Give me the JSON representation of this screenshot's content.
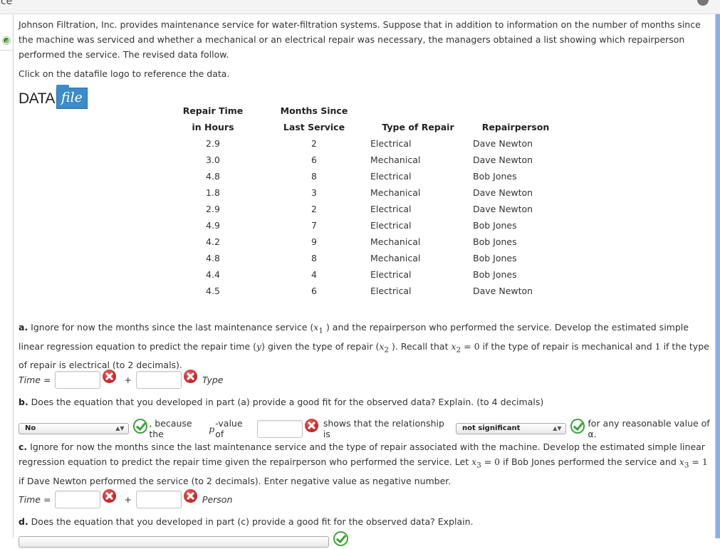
{
  "header": {
    "title": "ice",
    "info_icon": "info-icon"
  },
  "intro": {
    "text": "Johnson Filtration, Inc. provides maintenance service for water-filtration systems. Suppose that in addition to information on the number of months since the machine was serviced and whether a mechanical or an electrical repair was necessary, the managers obtained a list showing which repairperson performed the service. The revised data follow.",
    "click_note": "Click on the datafile logo to reference the data.",
    "datafile_logo": {
      "data": "DATA",
      "file": "file"
    }
  },
  "table": {
    "headers": [
      [
        "Repair Time",
        "in Hours"
      ],
      [
        "Months Since",
        "Last Service"
      ],
      [
        "",
        "Type of Repair"
      ],
      [
        "",
        "Repairperson"
      ]
    ],
    "rows": [
      [
        "2.9",
        "2",
        "Electrical",
        "Dave Newton"
      ],
      [
        "3.0",
        "6",
        "Mechanical",
        "Dave Newton"
      ],
      [
        "4.8",
        "8",
        "Electrical",
        "Bob Jones"
      ],
      [
        "1.8",
        "3",
        "Mechanical",
        "Dave Newton"
      ],
      [
        "2.9",
        "2",
        "Electrical",
        "Dave Newton"
      ],
      [
        "4.9",
        "7",
        "Electrical",
        "Bob Jones"
      ],
      [
        "4.2",
        "9",
        "Mechanical",
        "Bob Jones"
      ],
      [
        "4.8",
        "8",
        "Mechanical",
        "Bob Jones"
      ],
      [
        "4.4",
        "4",
        "Electrical",
        "Bob Jones"
      ],
      [
        "4.5",
        "6",
        "Electrical",
        "Dave Newton"
      ]
    ]
  },
  "part_a": {
    "label": "a.",
    "t1": " Ignore for now the months since the last maintenance service (",
    "x1": "x",
    "x1sub": "1",
    "t2": " ) and the repairperson who performed the service. Develop the estimated simple linear regression equation to predict the repair time (",
    "y": "y",
    "t3": ") given the type of repair (",
    "x2": "x",
    "x2sub": "2",
    "t4": " ). Recall that ",
    "eq1": " = 0",
    "t5": " if the type of repair is mechanical and ",
    "one": "1",
    "t6": " if the type of repair is electrical (to 2 decimals).",
    "time_label": "Time =",
    "plus": "+",
    "suffix": "Type",
    "input1_value": "",
    "input2_value": "",
    "input1_status": "incorrect",
    "input2_status": "incorrect"
  },
  "part_b": {
    "label": "b.",
    "text": " Does the equation that you developed in part (a) provide a good fit for the observed data? Explain. (to 4 decimals)",
    "select1_value": "No",
    "select1_status": "correct",
    "t1": ", because the ",
    "p": "p",
    "t2": "-value of",
    "pvalue_input": "",
    "pvalue_status": "incorrect",
    "t3": "shows that the relationship is",
    "select2_value": "not significant",
    "select2_status": "correct",
    "t4": "for any reasonable value of α."
  },
  "part_c": {
    "label": "c.",
    "t1": " Ignore for now the months since the last maintenance service and the type of repair associated with the machine. Develop the estimated simple linear regression equation to predict the repair time given the repairperson who performed the service. Let ",
    "x3": "x",
    "x3sub": "3",
    "eq0": " = 0",
    "t2": " if Bob Jones performed the service and ",
    "eq1": " = 1",
    "t3": " if Dave Newton performed the service (to 2 decimals). Enter negative value as negative number.",
    "time_label": "Time =",
    "plus": "+",
    "suffix": "Person",
    "input1_value": "",
    "input2_value": "",
    "input1_status": "incorrect",
    "input2_status": "incorrect"
  },
  "part_d": {
    "label": "d.",
    "text": " Does the equation that you developed in part (c) provide a good fit for the observed data? Explain.",
    "select_status": "correct"
  }
}
